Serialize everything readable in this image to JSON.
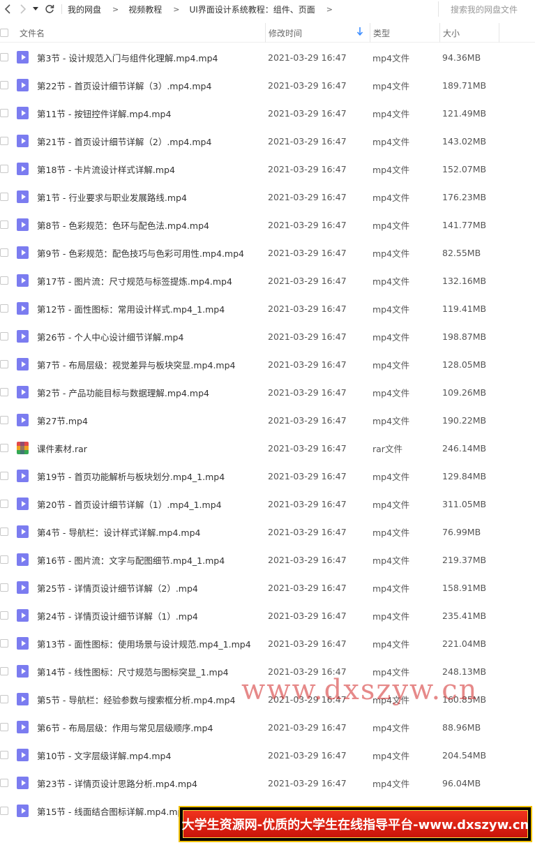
{
  "nav": {
    "back_icon": "chevron-left-icon",
    "forward_icon": "chevron-right-icon",
    "dropdown_icon": "caret-down-icon",
    "refresh_icon": "refresh-icon",
    "breadcrumb": [
      "我的网盘",
      "视频教程",
      "UI界面设计系统教程：组件、页面"
    ],
    "search_placeholder": "搜索我的网盘文件"
  },
  "columns": {
    "name": "文件名",
    "time": "修改时间",
    "type": "类型",
    "size": "大小"
  },
  "files": [
    {
      "name": "第3节 - 设计规范入门与组件化理解.mp4.mp4",
      "time": "2021-03-29 16:47",
      "type": "mp4文件",
      "size": "94.36MB",
      "icon": "video-file-icon"
    },
    {
      "name": "第22节 - 首页设计细节详解（3）.mp4.mp4",
      "time": "2021-03-29 16:47",
      "type": "mp4文件",
      "size": "189.71MB",
      "icon": "video-file-icon"
    },
    {
      "name": "第11节 - 按钮控件详解.mp4.mp4",
      "time": "2021-03-29 16:47",
      "type": "mp4文件",
      "size": "121.49MB",
      "icon": "video-file-icon"
    },
    {
      "name": "第21节 - 首页设计细节详解（2）.mp4.mp4",
      "time": "2021-03-29 16:47",
      "type": "mp4文件",
      "size": "143.02MB",
      "icon": "video-file-icon"
    },
    {
      "name": "第18节 - 卡片流设计样式详解.mp4",
      "time": "2021-03-29 16:47",
      "type": "mp4文件",
      "size": "152.07MB",
      "icon": "video-file-icon"
    },
    {
      "name": "第1节 - 行业要求与职业发展路线.mp4",
      "time": "2021-03-29 16:47",
      "type": "mp4文件",
      "size": "176.23MB",
      "icon": "video-file-icon"
    },
    {
      "name": "第8节 - 色彩规范：色环与配色法.mp4.mp4",
      "time": "2021-03-29 16:47",
      "type": "mp4文件",
      "size": "141.77MB",
      "icon": "video-file-icon"
    },
    {
      "name": "第9节 - 色彩规范：配色技巧与色彩可用性.mp4.mp4",
      "time": "2021-03-29 16:47",
      "type": "mp4文件",
      "size": "82.55MB",
      "icon": "video-file-icon"
    },
    {
      "name": "第17节 - 图片流：尺寸规范与标签提炼.mp4.mp4",
      "time": "2021-03-29 16:47",
      "type": "mp4文件",
      "size": "132.16MB",
      "icon": "video-file-icon"
    },
    {
      "name": "第12节 - 面性图标：常用设计样式.mp4_1.mp4",
      "time": "2021-03-29 16:47",
      "type": "mp4文件",
      "size": "119.41MB",
      "icon": "video-file-icon"
    },
    {
      "name": "第26节 - 个人中心设计细节详解.mp4",
      "time": "2021-03-29 16:47",
      "type": "mp4文件",
      "size": "198.87MB",
      "icon": "video-file-icon"
    },
    {
      "name": "第7节 - 布局层级：视觉差异与板块突显.mp4.mp4",
      "time": "2021-03-29 16:47",
      "type": "mp4文件",
      "size": "128.05MB",
      "icon": "video-file-icon"
    },
    {
      "name": "第2节 - 产品功能目标与数据理解.mp4.mp4",
      "time": "2021-03-29 16:47",
      "type": "mp4文件",
      "size": "109.26MB",
      "icon": "video-file-icon"
    },
    {
      "name": "第27节.mp4",
      "time": "2021-03-29 16:47",
      "type": "mp4文件",
      "size": "190.22MB",
      "icon": "video-file-icon"
    },
    {
      "name": "课件素材.rar",
      "time": "2021-03-29 16:47",
      "type": "rar文件",
      "size": "246.14MB",
      "icon": "rar-archive-icon"
    },
    {
      "name": "第19节 - 首页功能解析与板块划分.mp4_1.mp4",
      "time": "2021-03-29 16:47",
      "type": "mp4文件",
      "size": "129.84MB",
      "icon": "video-file-icon"
    },
    {
      "name": "第20节 - 首页设计细节详解（1）.mp4_1.mp4",
      "time": "2021-03-29 16:47",
      "type": "mp4文件",
      "size": "311.05MB",
      "icon": "video-file-icon"
    },
    {
      "name": "第4节 - 导航栏：设计样式详解.mp4.mp4",
      "time": "2021-03-29 16:47",
      "type": "mp4文件",
      "size": "76.99MB",
      "icon": "video-file-icon"
    },
    {
      "name": "第16节 - 图片流：文字与配图细节.mp4_1.mp4",
      "time": "2021-03-29 16:47",
      "type": "mp4文件",
      "size": "219.37MB",
      "icon": "video-file-icon"
    },
    {
      "name": "第25节 - 详情页设计细节详解（2）.mp4",
      "time": "2021-03-29 16:47",
      "type": "mp4文件",
      "size": "158.91MB",
      "icon": "video-file-icon"
    },
    {
      "name": "第24节 - 详情页设计细节详解（1）.mp4",
      "time": "2021-03-29 16:47",
      "type": "mp4文件",
      "size": "235.41MB",
      "icon": "video-file-icon"
    },
    {
      "name": "第13节 - 面性图标：使用场景与设计规范.mp4_1.mp4",
      "time": "2021-03-29 16:47",
      "type": "mp4文件",
      "size": "221.04MB",
      "icon": "video-file-icon"
    },
    {
      "name": "第14节 - 线性图标：尺寸规范与图标突显_1.mp4",
      "time": "2021-03-29 16:47",
      "type": "mp4文件",
      "size": "248.13MB",
      "icon": "video-file-icon"
    },
    {
      "name": "第5节 - 导航栏：经验参数与搜索框分析.mp4.mp4",
      "time": "2021-03-29 16:47",
      "type": "mp4文件",
      "size": "160.85MB",
      "icon": "video-file-icon"
    },
    {
      "name": "第6节 - 布局层级：作用与常见层级顺序.mp4",
      "time": "2021-03-29 16:47",
      "type": "mp4文件",
      "size": "88.96MB",
      "icon": "video-file-icon"
    },
    {
      "name": "第10节 - 文字层级详解.mp4.mp4",
      "time": "2021-03-29 16:47",
      "type": "mp4文件",
      "size": "204.54MB",
      "icon": "video-file-icon"
    },
    {
      "name": "第23节 - 详情页设计思路分析.mp4.mp4",
      "time": "2021-03-29 16:47",
      "type": "mp4文件",
      "size": "96.04MB",
      "icon": "video-file-icon"
    },
    {
      "name": "第15节 - 线面结合图标详解.mp4.mp4",
      "time": "",
      "type": "",
      "size": "",
      "icon": "video-file-icon"
    }
  ],
  "watermark": {
    "url_text": "www.dxszyw.cn",
    "banner_text": "大学生资源网-优质的大学生在线指导平台-www.dxszyw.cn",
    "url_color": "#d22828",
    "banner_color": "#e0281a"
  },
  "colors": {
    "accent": "#3b8cff",
    "video_icon": "#7b7cf0"
  }
}
